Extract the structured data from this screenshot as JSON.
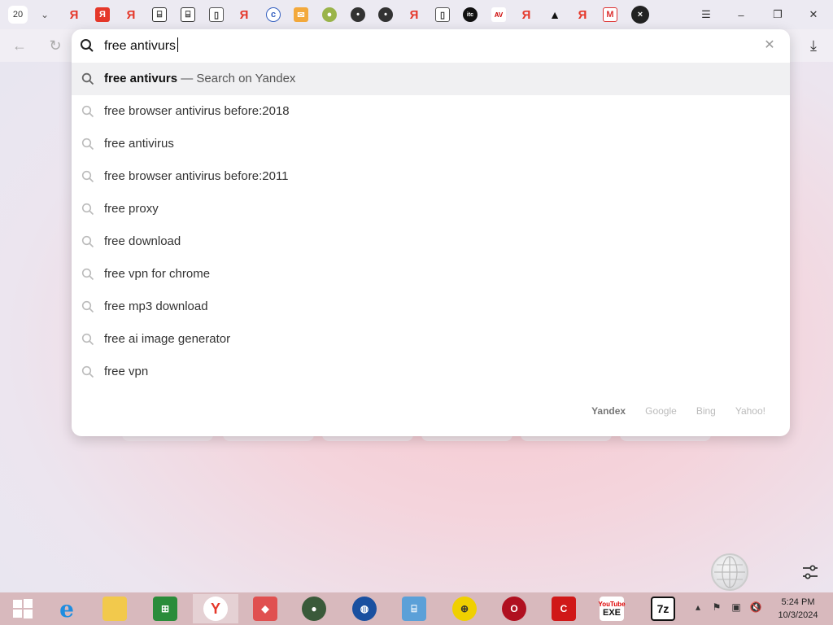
{
  "tabs": {
    "count": "20",
    "icons": [
      "yandex-tab-icon",
      "yandex-red-tab-icon",
      "yandex-tab-icon",
      "museum-tab-icon",
      "museum-tab-icon",
      "document-tab-icon",
      "yandex-tab-icon",
      "shield-tab-icon",
      "mail-tab-icon",
      "puzzle-tab-icon",
      "avatar-tab-icon",
      "avatar-tab-icon",
      "yandex-tab-icon",
      "document-tab-icon",
      "itc-tab-icon",
      "av-test-tab-icon",
      "yandex-tab-icon",
      "triangle-tab-icon",
      "yandex-tab-icon",
      "gmail-tab-icon",
      "active-tab-close-icon"
    ]
  },
  "omnibox": {
    "query": "free antivurs",
    "clear_icon": "close-icon"
  },
  "suggestions": [
    {
      "bold": "free antivurs",
      "hint": " — Search on Yandex"
    },
    {
      "text": "free browser antivirus before:2018"
    },
    {
      "text": "free antivirus"
    },
    {
      "text": "free browser antivirus before:2011"
    },
    {
      "text": "free proxy"
    },
    {
      "text": "free download"
    },
    {
      "text": "free vpn for chrome"
    },
    {
      "text": "free mp3 download"
    },
    {
      "text": "free ai image generator"
    },
    {
      "text": "free vpn"
    }
  ],
  "engines": [
    "Yandex",
    "Google",
    "Bing",
    "Yahoo!"
  ],
  "taskbar": {
    "apps": [
      "windows-start-icon",
      "internet-explorer-icon",
      "file-explorer-icon",
      "store-icon",
      "yandex-browser-icon",
      "app-icon",
      "user-app-icon",
      "globe-app-icon",
      "network-app-icon",
      "web-app-icon",
      "opera-app-icon",
      "c-app-icon",
      "youtube-exe-icon",
      "7zip-icon"
    ],
    "seven_zip": "7z",
    "yt_exe_top": "YouTube",
    "yt_exe_bottom": "EXE"
  },
  "clock": {
    "time": "5:24 PM",
    "date": "10/3/2024"
  }
}
